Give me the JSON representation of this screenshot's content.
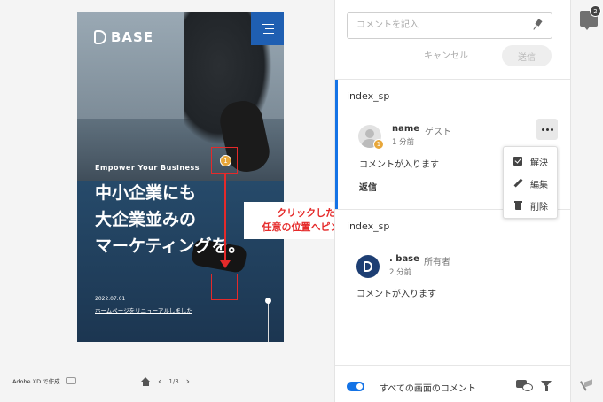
{
  "canvas": {
    "logo_text": "BASE",
    "tagline": "Empower Your Business",
    "headline_lines": [
      "中小企業にも",
      "大企業並みの",
      "マーケティングを。"
    ],
    "date": "2022.07.01",
    "news_link": "ホームページをリニューアルしました",
    "pin_number": "1",
    "callout_lines": [
      "クリックしたまま",
      "任意の位置へピンを移動"
    ],
    "footer_brand": "Adobe XD で作成",
    "page_indicator": "1/3"
  },
  "panel": {
    "input_placeholder": "コメントを記入",
    "cancel_label": "キャンセル",
    "send_label": "送信",
    "threads": [
      {
        "title": "index_sp",
        "author": "name",
        "role": "ゲスト",
        "time": "1 分前",
        "body": "コメントが入ります",
        "reply_label": "返信",
        "pin_number": "1"
      },
      {
        "title": "index_sp",
        "author": ". base",
        "role": "所有者",
        "time": "2 分前",
        "body": "コメントが入ります"
      }
    ],
    "context_menu": [
      "解決",
      "編集",
      "削除"
    ],
    "footer_toggle_label": "すべての画面のコメント"
  },
  "rail": {
    "comment_count": "2"
  },
  "colors": {
    "accent_blue": "#1473e6",
    "pin_orange": "#e8a73a",
    "annotation_red": "#e52a2a",
    "brand_navy": "#1d3e73"
  }
}
